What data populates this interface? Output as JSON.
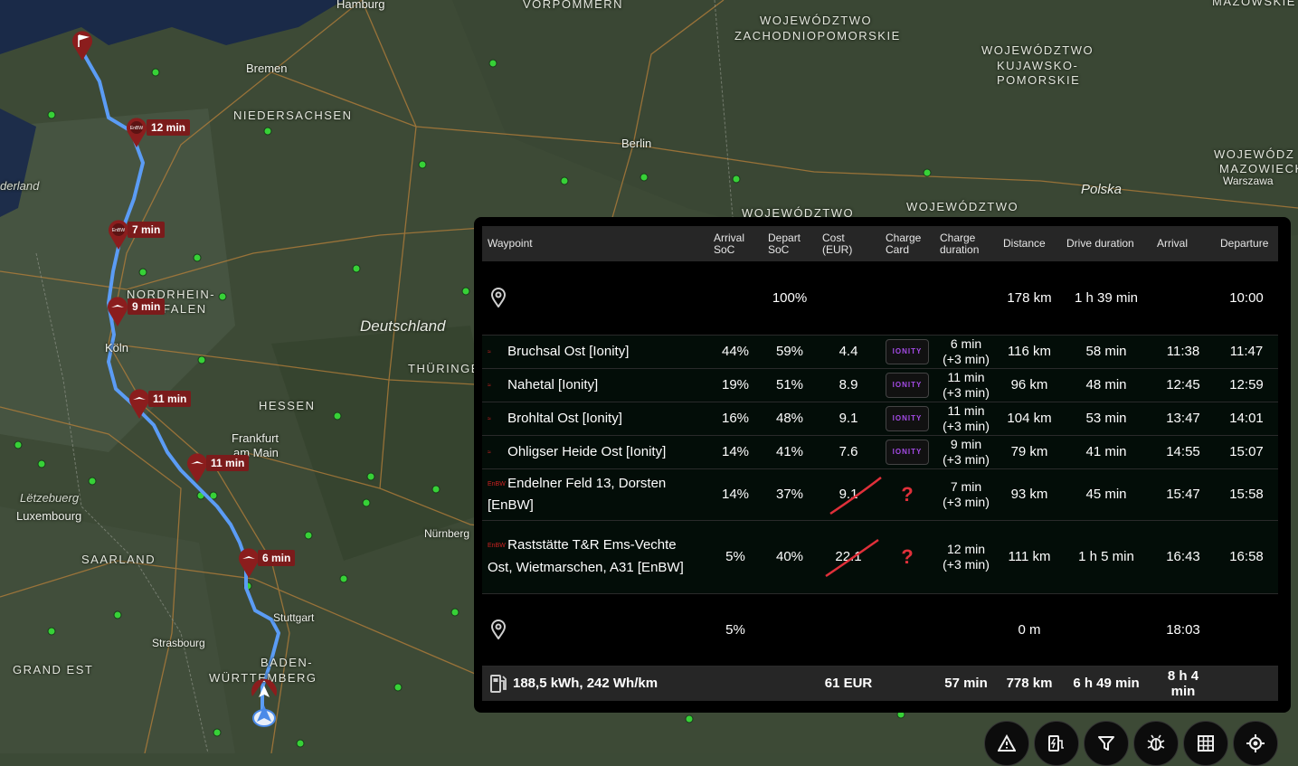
{
  "map": {
    "labels": {
      "hamburg": "Hamburg",
      "vorpommern": "VORPOMMERN",
      "zachodnio1": "WOJEWÓDZTWO",
      "zachodnio2": "ZACHODNIOPOMORSKIE",
      "kujawsko1": "WOJEWÓDZTWO",
      "kujawsko2": "KUJAWSKO-",
      "kujawsko3": "POMORSKIE",
      "masov1": "WOJEWÓDZ",
      "masov2": "MAZOWIECK",
      "warszawa": "Warszawa",
      "polska": "Polska",
      "woj_a": "WOJEWÓDZTWO",
      "woj_b": "WOJEWÓDZTWO",
      "bremen": "Bremen",
      "niedersachsen": "NIEDERSACHSEN",
      "berlin": "Berlin",
      "nederland": "derland",
      "nrw1": "NORDRHEIN-",
      "nrw2": "FALEN",
      "deutschland": "Deutschland",
      "thueringen": "THÜRINGE",
      "koeln": "Köln",
      "hessen": "HESSEN",
      "frankfurt1": "Frankfurt",
      "frankfurt2": "am Main",
      "letzebuerg": "Lëtzebuerg",
      "luxembourg": "Luxembourg",
      "nuernberg": "Nürnberg",
      "saarland": "SAARLAND",
      "stuttgart": "Stuttgart",
      "strasbourg": "Strasbourg",
      "bw1": "BADEN-",
      "bw2": "WÜRTTEMBERG",
      "grandest": "GRAND EST",
      "masovtop": "MAZOWSKIE"
    },
    "route_pins": [
      {
        "icon": "enbw",
        "label": "12 min"
      },
      {
        "icon": "enbw",
        "label": "7 min"
      },
      {
        "icon": "ionity",
        "label": "9 min"
      },
      {
        "icon": "ionity",
        "label": "11 min"
      },
      {
        "icon": "ionity",
        "label": "11 min"
      },
      {
        "icon": "ionity",
        "label": "6 min"
      }
    ],
    "destination_icon": "flag-icon",
    "current_location_icon": "navigation-arrow-icon"
  },
  "table": {
    "headers": {
      "waypoint": "Waypoint",
      "arrival_soc": "Arrival SoC",
      "depart_soc": "Depart SoC",
      "cost": "Cost (EUR)",
      "charge_card": "Charge Card",
      "charge_duration": "Charge duration",
      "distance": "Distance",
      "drive_duration": "Drive duration",
      "arrival": "Arrival",
      "departure": "Departure"
    },
    "start": {
      "icon": "location-pin-icon",
      "depart_soc": "100%",
      "distance": "178 km",
      "drive": "1 h 39 min",
      "departure": "10:00"
    },
    "rows": [
      {
        "logo": "ionity",
        "name": "Bruchsal Ost [Ionity]",
        "arrival_soc": "44%",
        "depart_soc": "59%",
        "cost": "4.4",
        "card": "IONITY",
        "charge": "6 min (+3 min)",
        "distance": "116 km",
        "drive": "58 min",
        "arrival": "11:38",
        "departure": "11:47"
      },
      {
        "logo": "ionity",
        "name": "Nahetal [Ionity]",
        "arrival_soc": "19%",
        "depart_soc": "51%",
        "cost": "8.9",
        "card": "IONITY",
        "charge": "11 min (+3 min)",
        "distance": "96 km",
        "drive": "48 min",
        "arrival": "12:45",
        "departure": "12:59"
      },
      {
        "logo": "ionity",
        "name": "Brohltal Ost [Ionity]",
        "arrival_soc": "16%",
        "depart_soc": "48%",
        "cost": "9.1",
        "card": "IONITY",
        "charge": "11 min (+3 min)",
        "distance": "104 km",
        "drive": "53 min",
        "arrival": "13:47",
        "departure": "14:01"
      },
      {
        "logo": "ionity",
        "name": "Ohligser Heide Ost [Ionity]",
        "arrival_soc": "14%",
        "depart_soc": "41%",
        "cost": "7.6",
        "card": "IONITY",
        "charge": "9 min (+3 min)",
        "distance": "79 km",
        "drive": "41 min",
        "arrival": "14:55",
        "departure": "15:07"
      },
      {
        "logo": "enbw",
        "name": "Endelner Feld 13, Dorsten [EnBW]",
        "arrival_soc": "14%",
        "depart_soc": "37%",
        "cost": "9.1",
        "card": "?",
        "charge": "7 min (+3 min)",
        "distance": "93 km",
        "drive": "45 min",
        "arrival": "15:47",
        "departure": "15:58"
      },
      {
        "logo": "enbw",
        "name": "Raststätte T&R Ems-Vechte Ost, Wietmarschen, A31 [EnBW]",
        "arrival_soc": "5%",
        "depart_soc": "40%",
        "cost": "22.1",
        "card": "?",
        "charge": "12 min (+3 min)",
        "distance": "111 km",
        "drive": "1 h 5 min",
        "arrival": "16:43",
        "departure": "16:58"
      }
    ],
    "end": {
      "icon": "location-pin-icon",
      "arrival_soc": "5%",
      "distance": "0 m",
      "arrival": "18:03"
    },
    "footer": {
      "icon": "fuel-pump-icon",
      "energy": "188,5 kWh, 242 Wh/km",
      "cost": "61 EUR",
      "charge": "57 min",
      "distance": "778 km",
      "drive": "6 h 49 min",
      "total": "8 h 4 min"
    },
    "logo_text": {
      "ionity": "≈",
      "enbw": "EnBW"
    }
  },
  "toolbar": [
    "warning-icon",
    "charger-icon",
    "filter-icon",
    "bug-icon",
    "grid-icon",
    "locate-icon"
  ],
  "colors": {
    "route": "#5b9cf5",
    "pin": "#8b1d1d",
    "charger_dot": "#3ed13e",
    "panel": "#000000"
  }
}
